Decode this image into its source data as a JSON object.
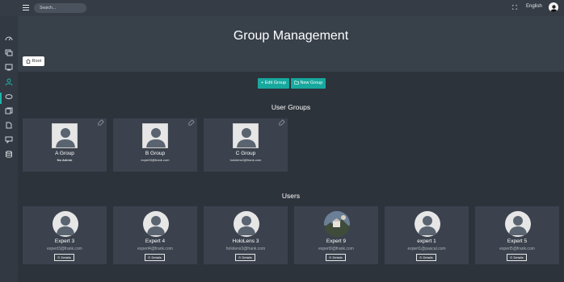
{
  "topbar": {
    "search_placeholder": "Search...",
    "language": "English"
  },
  "page": {
    "title": "Group Management",
    "breadcrumb": "Root"
  },
  "actions": {
    "edit_group": "Edit Group",
    "new_group": "New Group"
  },
  "groups": {
    "section_title": "User Groups",
    "items": [
      {
        "name": "A Group",
        "subtitle": "No Admin"
      },
      {
        "name": "B Group",
        "subtitle": "expert3@frank.com"
      },
      {
        "name": "C Group",
        "subtitle": "hololens3@frank.com"
      }
    ]
  },
  "users": {
    "section_title": "Users",
    "details_label": "Details",
    "items": [
      {
        "name": "Expert 3",
        "email": "expert3@frank.com"
      },
      {
        "name": "Expert 4",
        "email": "expert4@frank.com"
      },
      {
        "name": "HoloLens 3",
        "email": "hololens3@frank.com"
      },
      {
        "name": "Expert 9",
        "email": "expert9@frank.com"
      },
      {
        "name": "expert 1",
        "email": "expert1@pascal.com"
      },
      {
        "name": "Expert 5",
        "email": "expert5@frank.com"
      }
    ]
  },
  "colors": {
    "accent": "#17a89e",
    "background": "#2d333b",
    "card": "#3b424d"
  }
}
